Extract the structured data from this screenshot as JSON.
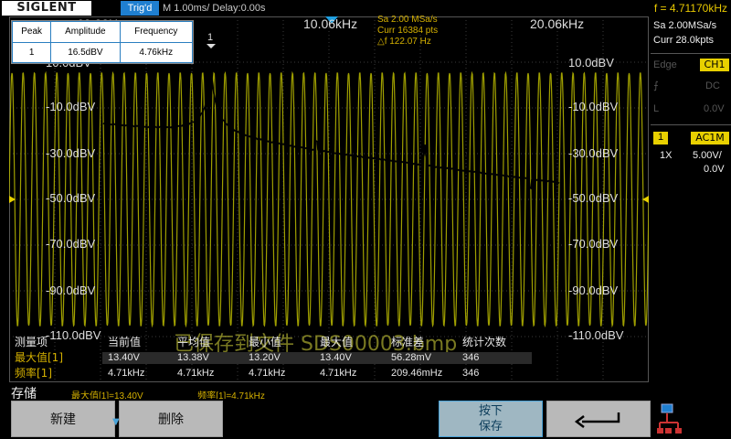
{
  "topbar": {
    "logo": "SIGLENT",
    "trig_status": "Trig'd",
    "timebase": "M 1.00ms/ Delay:0.00s",
    "trigger_freq": "f = 4.71170kHz"
  },
  "plot": {
    "freq_labels": [
      "60.00Hz",
      "10.06kHz",
      "20.06kHz"
    ],
    "db_left": [
      "10.0dBV",
      "-10.0dBV",
      "-30.0dBV",
      "-50.0dBV",
      "-70.0dBV",
      "-90.0dBV",
      "-110.0dBV"
    ],
    "db_right": [
      "10.0dBV",
      "-10.0dBV",
      "-30.0dBV",
      "-50.0dBV",
      "-70.0dBV",
      "-90.0dBV",
      "-110.0dBV"
    ],
    "peak_marker": "1",
    "save_message": "已保存到文件 SDS00003.bmp",
    "colors": {
      "waveform": "#b0b000",
      "fft": "#000000",
      "grid": "#3a3a3a",
      "accent": "#e8d000",
      "brand": "#1f7fd0"
    }
  },
  "peak_table": {
    "headers": [
      "Peak",
      "Amplitude",
      "Frequency"
    ],
    "rows": [
      [
        "1",
        "16.5dBV",
        "4.76kHz"
      ]
    ]
  },
  "math_info": {
    "sa": "Sa 2.00 MSa/s",
    "curr": "Curr 16384 pts",
    "df": "△f 122.07 Hz"
  },
  "right_panel": {
    "sa": "Sa 2.00MSa/s",
    "curr": "Curr 28.0kpts",
    "trig_type": "Edge",
    "trig_src": "CH1",
    "trig_coupling": "DC",
    "trig_level": "0.0V",
    "ch_coupling": "AC1M",
    "ch_probe": "1X",
    "ch_scale": "5.00V/",
    "ch_offset": "0.0V"
  },
  "measurements": {
    "headers": [
      "测量项",
      "当前值",
      "平均值",
      "最小值",
      "最大值",
      "标准差",
      "统计次数"
    ],
    "rows": [
      {
        "name": "最大值[1]",
        "values": [
          "13.40V",
          "13.38V",
          "13.20V",
          "13.40V",
          "56.28mV",
          "346"
        ]
      },
      {
        "name": "频率[1]",
        "values": [
          "4.71kHz",
          "4.71kHz",
          "4.71kHz",
          "4.71kHz",
          "209.46mHz",
          "346"
        ]
      }
    ]
  },
  "bottom": {
    "storage_label": "存储",
    "status_max": "最大值[1]=13.40V",
    "status_freq": "频率[1]=4.71kHz",
    "btn_new": "新建",
    "btn_delete": "删除",
    "btn_save_line1": "按下",
    "btn_save_line2": "保存",
    "btn_back_icon": "return-arrow-icon",
    "net_icon": "network-icon"
  }
}
